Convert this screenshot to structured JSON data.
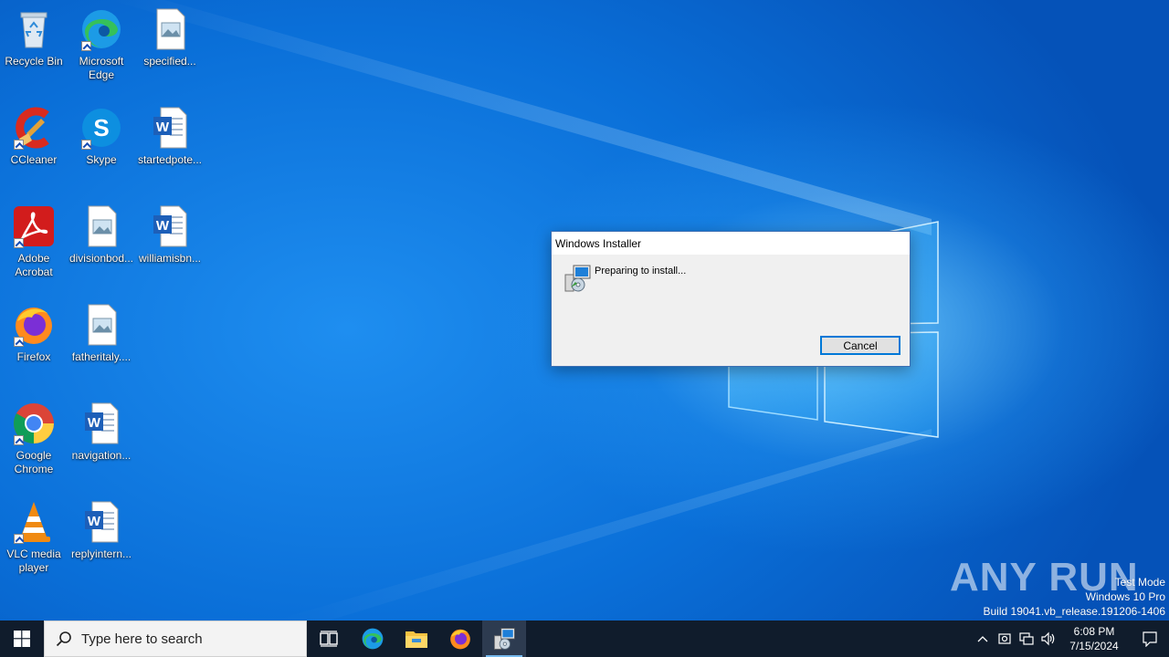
{
  "desktop": {
    "icons": [
      {
        "label": "Recycle Bin",
        "icon": "recycle-bin-icon"
      },
      {
        "label": "Microsoft Edge",
        "icon": "edge-icon"
      },
      {
        "label": "specified...",
        "icon": "image-file-icon"
      },
      {
        "label": "CCleaner",
        "icon": "ccleaner-icon"
      },
      {
        "label": "Skype",
        "icon": "skype-icon"
      },
      {
        "label": "startedpote...",
        "icon": "word-document-icon"
      },
      {
        "label": "Adobe Acrobat",
        "icon": "acrobat-icon"
      },
      {
        "label": "divisionbod...",
        "icon": "image-file-icon"
      },
      {
        "label": "williamisbn...",
        "icon": "word-document-icon"
      },
      {
        "label": "Firefox",
        "icon": "firefox-icon"
      },
      {
        "label": "fatheritaly....",
        "icon": "image-file-icon"
      },
      {
        "label": "Google Chrome",
        "icon": "chrome-icon"
      },
      {
        "label": "navigation...",
        "icon": "word-document-icon"
      },
      {
        "label": "VLC media player",
        "icon": "vlc-icon"
      },
      {
        "label": "replyintern...",
        "icon": "word-document-icon"
      }
    ]
  },
  "installer": {
    "title": "Windows Installer",
    "message": "Preparing to install...",
    "cancel_label": "Cancel"
  },
  "watermark": {
    "brand": "ANY RUN",
    "line1": "Test Mode",
    "line2": "Windows 10 Pro",
    "line3": "Build 19041.vb_release.191206-1406"
  },
  "taskbar": {
    "search_placeholder": "Type here to search",
    "apps": [
      "task-view-icon",
      "edge-icon",
      "file-explorer-icon",
      "firefox-icon",
      "installer-icon"
    ],
    "active_app": "installer-icon",
    "tray_icons": [
      "chevron-up-icon",
      "defender-icon",
      "network-icon",
      "volume-icon"
    ],
    "time": "6:08 PM",
    "date": "7/15/2024"
  },
  "colors": {
    "taskbar": "#101c2c",
    "accent": "#0078d7",
    "wallpaper": "#0a74d8"
  }
}
